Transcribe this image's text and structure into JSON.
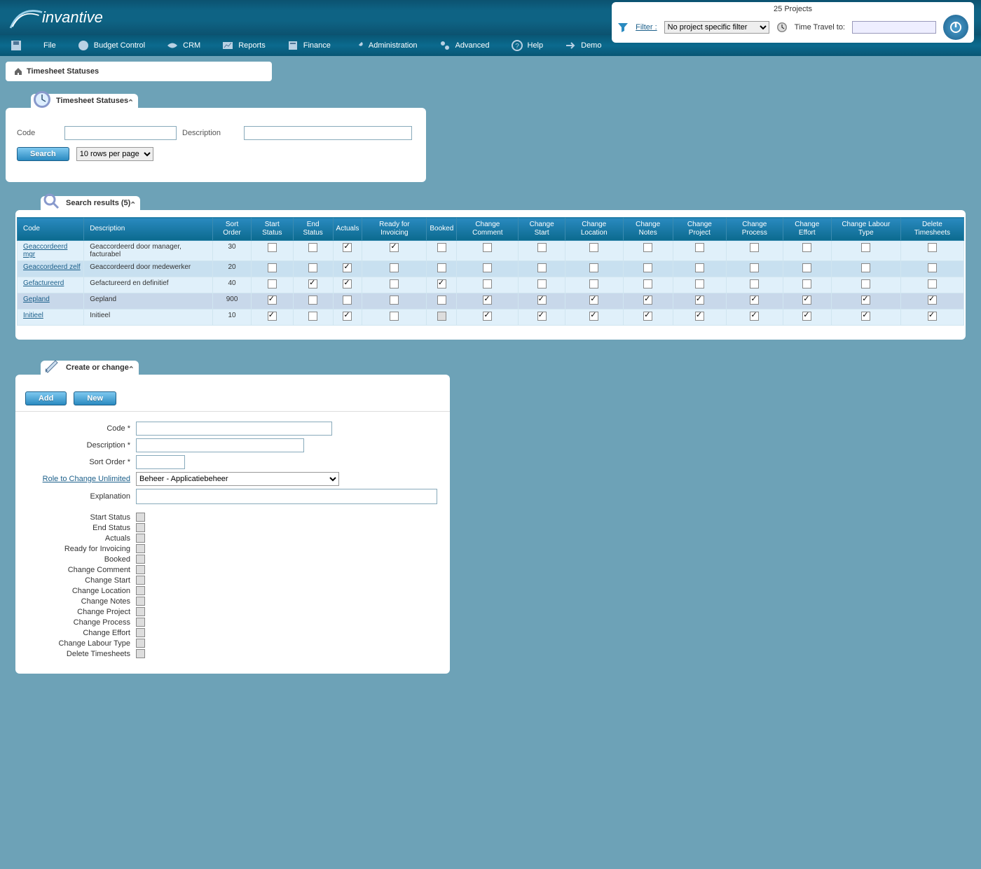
{
  "brand": "invantive",
  "top": {
    "projects_count": "25 Projects",
    "filter_label": "Filter :",
    "filter_value": "No project specific filter",
    "timetravel_label": "Time Travel to:",
    "timetravel_value": ""
  },
  "menu": {
    "file": "File",
    "budget": "Budget Control",
    "crm": "CRM",
    "reports": "Reports",
    "finance": "Finance",
    "admin": "Administration",
    "advanced": "Advanced",
    "help": "Help",
    "demo": "Demo"
  },
  "breadcrumb": "Timesheet Statuses",
  "search_panel": {
    "title": "Timesheet Statuses",
    "code_label": "Code",
    "desc_label": "Description",
    "search_btn": "Search",
    "rows_sel": "10 rows per page"
  },
  "results": {
    "title": "Search results (5)",
    "headers": [
      "Code",
      "Description",
      "Sort Order",
      "Start Status",
      "End Status",
      "Actuals",
      "Ready for Invoicing",
      "Booked",
      "Change Comment",
      "Change Start",
      "Change Location",
      "Change Notes",
      "Change Project",
      "Change Process",
      "Change Effort",
      "Change Labour Type",
      "Delete Timesheets"
    ],
    "rows": [
      {
        "code": "Geaccordeerd mgr",
        "desc": "Geaccordeerd door manager, facturabel",
        "sort": "30",
        "flags": [
          0,
          0,
          2,
          2,
          0,
          0,
          0,
          0,
          0,
          0,
          0,
          0,
          0,
          0
        ]
      },
      {
        "code": "Geaccordeerd zelf",
        "desc": "Geaccordeerd door medewerker",
        "sort": "20",
        "flags": [
          0,
          0,
          2,
          0,
          0,
          0,
          0,
          0,
          0,
          0,
          0,
          0,
          0,
          0
        ]
      },
      {
        "code": "Gefactureerd",
        "desc": "Gefactureerd en definitief",
        "sort": "40",
        "flags": [
          0,
          2,
          2,
          0,
          2,
          0,
          0,
          0,
          0,
          0,
          0,
          0,
          0,
          0
        ]
      },
      {
        "code": "Gepland",
        "desc": "Gepland",
        "sort": "900",
        "flags": [
          2,
          0,
          0,
          0,
          0,
          2,
          2,
          2,
          2,
          2,
          2,
          2,
          2,
          2
        ]
      },
      {
        "code": "Initieel",
        "desc": "Initieel",
        "sort": "10",
        "flags": [
          2,
          0,
          2,
          0,
          1,
          2,
          2,
          2,
          2,
          2,
          2,
          2,
          2,
          2
        ]
      }
    ]
  },
  "form": {
    "title": "Create or change",
    "add_btn": "Add",
    "new_btn": "New",
    "labels": {
      "code": "Code *",
      "desc": "Description *",
      "sort": "Sort Order *",
      "role": "Role to Change Unlimited",
      "expl": "Explanation",
      "start": "Start Status",
      "end": "End Status",
      "actuals": "Actuals",
      "ready": "Ready for Invoicing",
      "booked": "Booked",
      "chcomment": "Change Comment",
      "chstart": "Change Start",
      "chloc": "Change Location",
      "chnotes": "Change Notes",
      "chproj": "Change Project",
      "chproc": "Change Process",
      "cheff": "Change Effort",
      "chlab": "Change Labour Type",
      "del": "Delete Timesheets"
    },
    "role_value": "Beheer - Applicatiebeheer"
  }
}
